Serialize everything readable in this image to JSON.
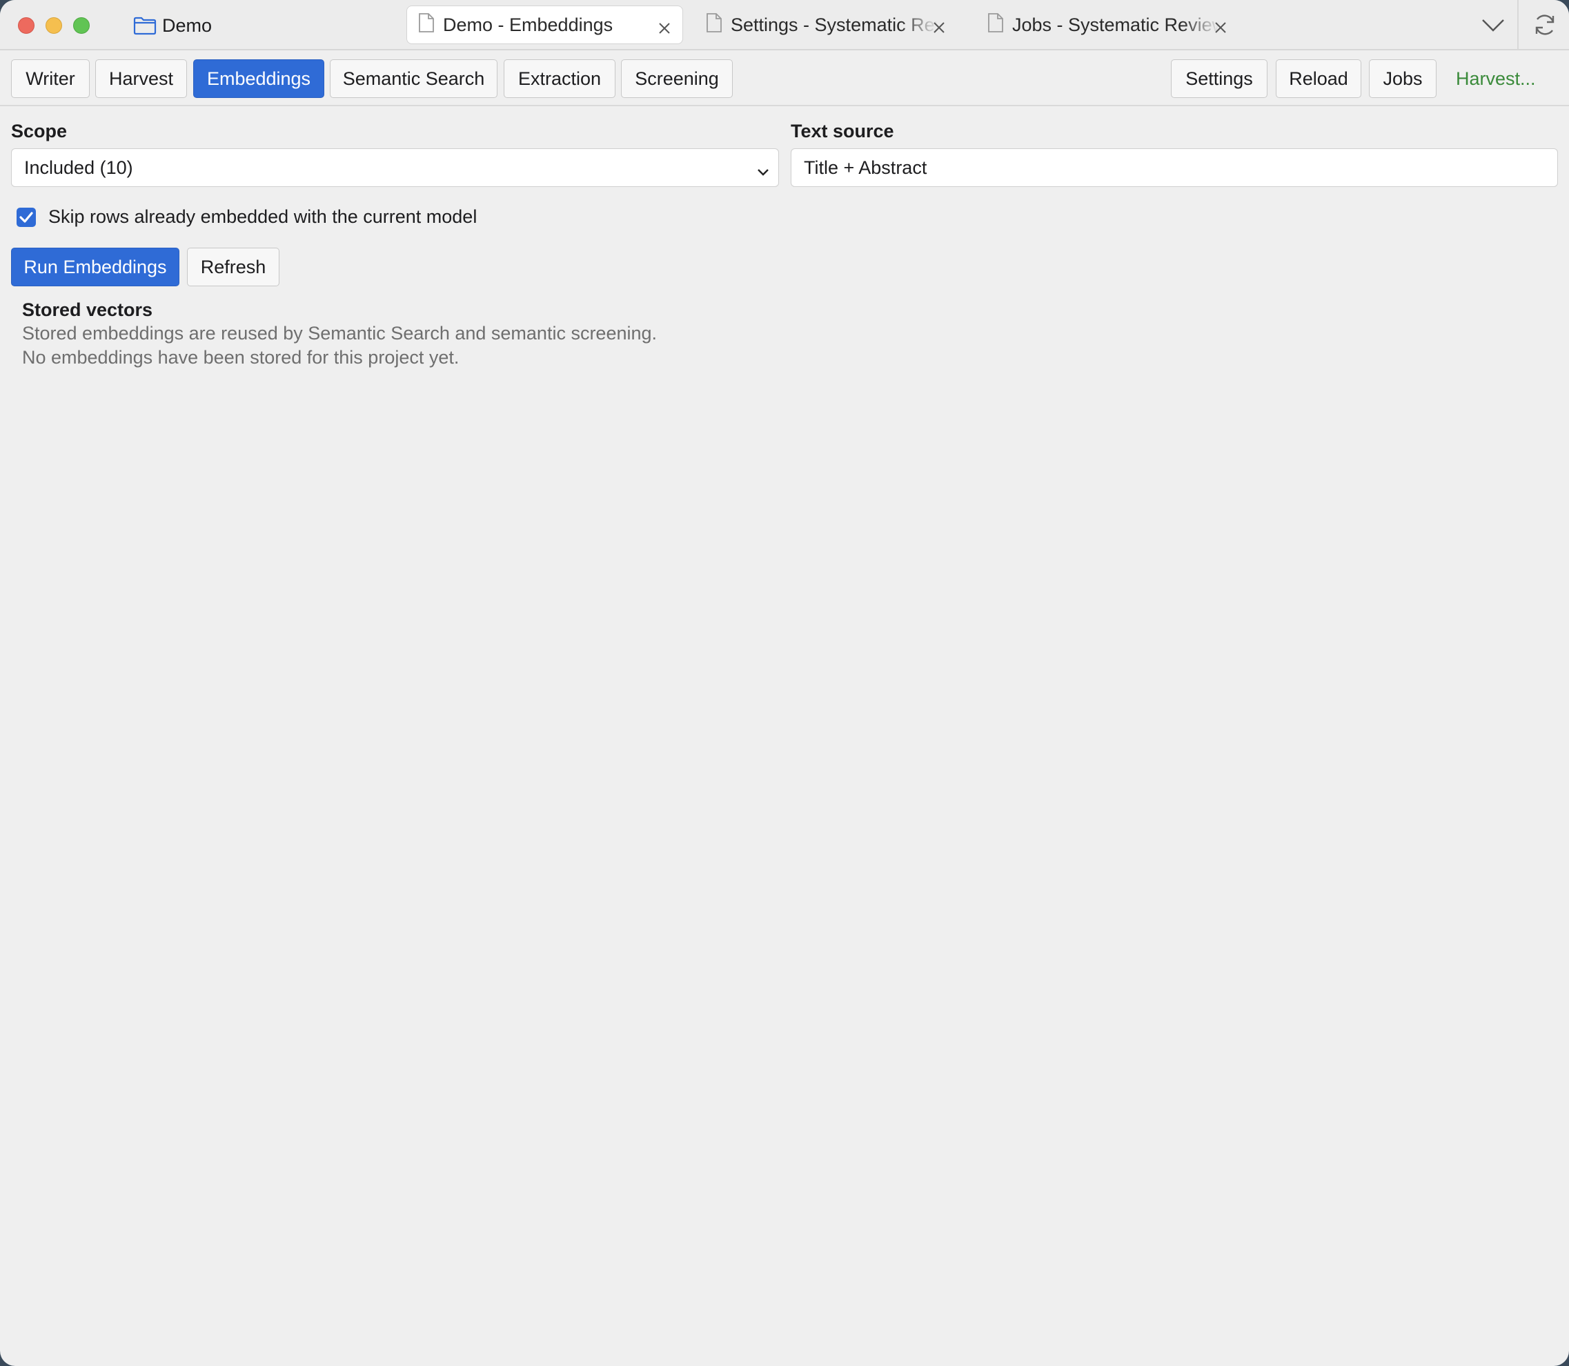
{
  "titlebar": {
    "project_name": "Demo",
    "tabs": [
      {
        "label": "Demo - Embeddings",
        "active": true
      },
      {
        "label": "Settings - Systematic Review",
        "active": false
      },
      {
        "label": "Jobs - Systematic Review",
        "active": false
      }
    ]
  },
  "toolbar": {
    "nav": [
      {
        "label": "Writer"
      },
      {
        "label": "Harvest"
      },
      {
        "label": "Embeddings",
        "active": true
      },
      {
        "label": "Semantic Search"
      },
      {
        "label": "Extraction"
      },
      {
        "label": "Screening"
      }
    ],
    "actions": {
      "settings": "Settings",
      "reload": "Reload",
      "jobs": "Jobs",
      "harvest": "Harvest..."
    }
  },
  "form": {
    "scope_label": "Scope",
    "scope_value": "Included (10)",
    "text_source_label": "Text source",
    "text_source_value": "Title + Abstract",
    "skip_label": "Skip rows already embedded with the current model",
    "skip_checked": true,
    "run_button": "Run Embeddings",
    "refresh_button": "Refresh"
  },
  "stored": {
    "title": "Stored vectors",
    "line1": "Stored embeddings are reused by Semantic Search and semantic screening.",
    "line2": "No embeddings have been stored for this project yet."
  },
  "colors": {
    "accent": "#2f6bd6",
    "link_green": "#3a8a3a"
  }
}
